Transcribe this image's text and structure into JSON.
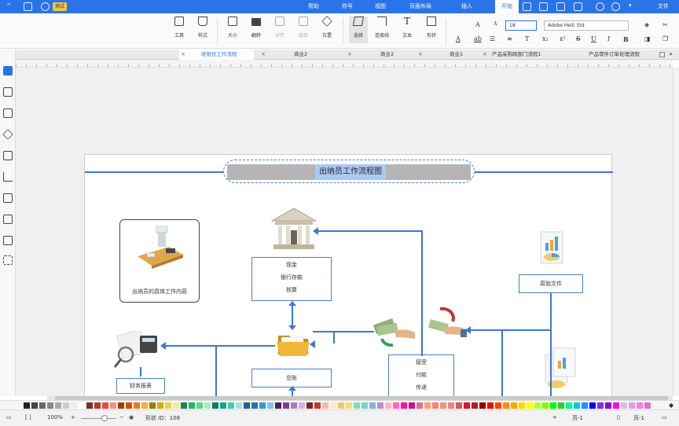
{
  "menubar": {
    "tabs": [
      "文件",
      "开始",
      "插入",
      "页面布局",
      "视图",
      "符号",
      "帮助"
    ],
    "active_tab": "开始",
    "beta": "测试",
    "bg": "#2b73e8"
  },
  "ribbon": {
    "font_name": "Adobe Heiti Std",
    "font_size": "18",
    "buttons": [
      "形状",
      "文本",
      "连接线",
      "选择",
      "位置",
      "组合",
      "对齐",
      "翻转",
      "大小",
      "样式",
      "工具"
    ]
  },
  "doctabs": [
    "产品零件订单处理流程",
    "产品采购跨部门流程1",
    "商业1",
    "商业2",
    "商业2",
    "收银员工作流程"
  ],
  "diagram": {
    "title": "出纳员工作流程图",
    "detail_card": "出纳员的具体工作内容",
    "bank_box": [
      "现金",
      "银行存款",
      "核算"
    ],
    "original_docs": "原始文件",
    "ledger": "总账",
    "money_box": [
      "接受",
      "付款",
      "传递"
    ],
    "finance_report": "财务报表"
  },
  "status": {
    "page": "页-1",
    "page2": "页-1",
    "shape_id": "形状 ID：108",
    "zoom": "100%"
  },
  "colors": {
    "accent": "#2b73e8",
    "connector": "#3a78d6",
    "title_fill": "#b5b5b5",
    "title_highlight": "#aac8f5"
  }
}
